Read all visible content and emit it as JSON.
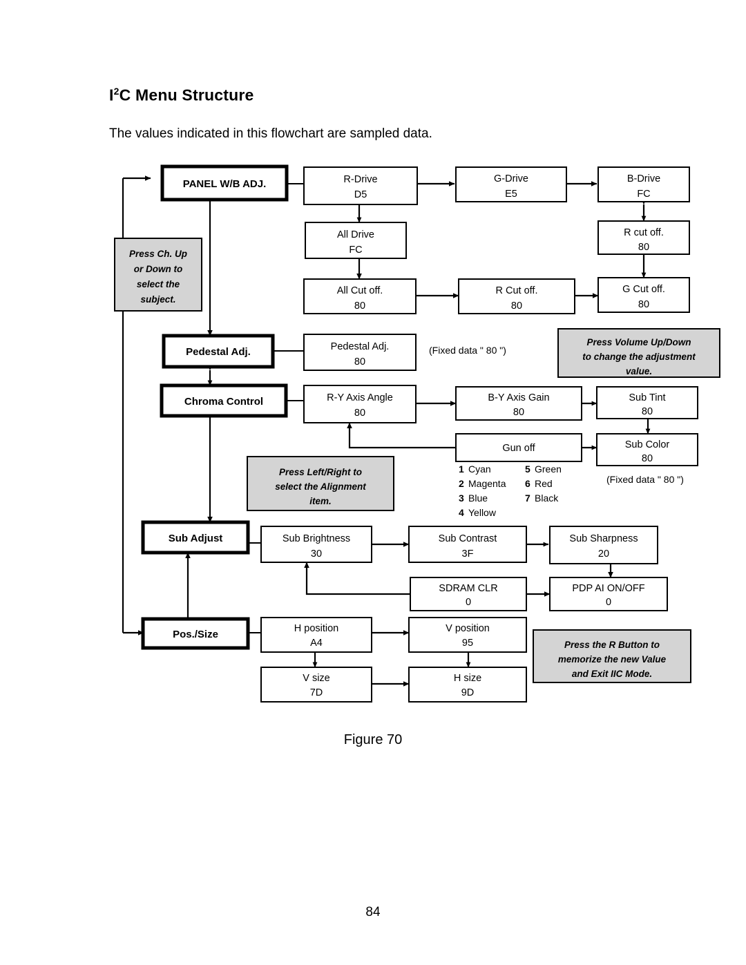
{
  "document": {
    "title_main": "C Menu Structure",
    "title_sup": "2",
    "title_prefix": "I",
    "subtitle": "The values indicated in this flowchart are sampled data.",
    "figure_caption": "Figure 70",
    "page_number": "84"
  },
  "diagram": {
    "menu_items": [
      {
        "id": "panel-wb-adj",
        "label": "PANEL W/B ADJ."
      },
      {
        "id": "pedestal-adj",
        "label": "Pedestal Adj."
      },
      {
        "id": "chroma-control",
        "label": "Chroma Control"
      },
      {
        "id": "sub-adjust",
        "label": "Sub Adjust"
      },
      {
        "id": "pos-size",
        "label": "Pos./Size"
      }
    ],
    "value_boxes": [
      {
        "id": "r-drive",
        "label": "R-Drive",
        "value": "D5"
      },
      {
        "id": "g-drive",
        "label": "G-Drive",
        "value": "E5"
      },
      {
        "id": "b-drive",
        "label": "B-Drive",
        "value": "FC"
      },
      {
        "id": "all-drive",
        "label": "All Drive",
        "value": "FC"
      },
      {
        "id": "r-cut-off-up",
        "label": "R cut off.",
        "value": "80"
      },
      {
        "id": "all-cut-off",
        "label": "All Cut off.",
        "value": "80"
      },
      {
        "id": "r-cut-off",
        "label": "R Cut off.",
        "value": "80"
      },
      {
        "id": "g-cut-off",
        "label": "G Cut off.",
        "value": "80"
      },
      {
        "id": "pedestal-val",
        "label": "Pedestal Adj.",
        "value": "80"
      },
      {
        "id": "ry-axis-angle",
        "label": "R-Y Axis Angle",
        "value": "80"
      },
      {
        "id": "by-axis-gain",
        "label": "B-Y Axis Gain",
        "value": "80"
      },
      {
        "id": "sub-tint",
        "label": "Sub Tint",
        "value": "80"
      },
      {
        "id": "gun-off",
        "label": "Gun off",
        "value": ""
      },
      {
        "id": "sub-color",
        "label": "Sub Color",
        "value": "80"
      },
      {
        "id": "sub-brightness",
        "label": "Sub Brightness",
        "value": "30"
      },
      {
        "id": "sub-contrast",
        "label": "Sub Contrast",
        "value": "3F"
      },
      {
        "id": "sub-sharpness",
        "label": "Sub Sharpness",
        "value": "20"
      },
      {
        "id": "sdram-clr",
        "label": "SDRAM CLR",
        "value": "0"
      },
      {
        "id": "pdp-ai",
        "label": "PDP AI ON/OFF",
        "value": "0"
      },
      {
        "id": "h-position",
        "label": "H position",
        "value": "A4"
      },
      {
        "id": "v-position",
        "label": "V position",
        "value": "95"
      },
      {
        "id": "v-size",
        "label": "V size",
        "value": "7D"
      },
      {
        "id": "h-size",
        "label": "H size",
        "value": "9D"
      }
    ],
    "notes": [
      {
        "id": "note-channel",
        "lines": [
          "Press Ch. Up",
          "or Down to",
          "select the",
          "subject."
        ]
      },
      {
        "id": "note-volume",
        "lines": [
          "Press Volume Up/Down",
          "to change the adjustment",
          "value."
        ]
      },
      {
        "id": "note-leftright",
        "lines": [
          "Press Left/Right to",
          "select the Alignment",
          "item."
        ]
      },
      {
        "id": "note-rbutton",
        "lines": [
          "Press the R Button to",
          "memorize the new Value",
          "and Exit IIC Mode."
        ]
      }
    ],
    "annotations": [
      {
        "id": "fixed-data-pedestal",
        "text": "(Fixed data \" 80 \")"
      },
      {
        "id": "fixed-data-subcolor",
        "text": "(Fixed data \" 80 \")"
      }
    ],
    "gun_off_legend": {
      "left": [
        {
          "num": "1",
          "name": "Cyan"
        },
        {
          "num": "2",
          "name": "Magenta"
        },
        {
          "num": "3",
          "name": "Blue"
        },
        {
          "num": "4",
          "name": "Yellow"
        }
      ],
      "right": [
        {
          "num": "5",
          "name": "Green"
        },
        {
          "num": "6",
          "name": "Red"
        },
        {
          "num": "7",
          "name": "Black"
        }
      ]
    }
  },
  "colors": {
    "note_fill": "#d4d4d4",
    "box_fill": "#ffffff",
    "line": "#000000"
  }
}
